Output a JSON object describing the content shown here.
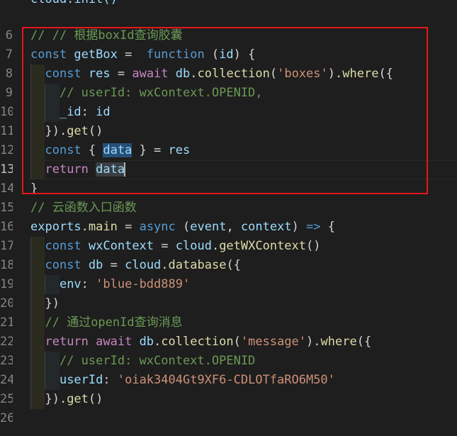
{
  "editor": {
    "top_partial_text": "cloud.init()",
    "lines": [
      {
        "num": "6",
        "tokens": [
          [
            "cmt",
            "// // 根据boxId查询胶囊"
          ]
        ]
      },
      {
        "num": "7",
        "tokens": [
          [
            "kw",
            "const "
          ],
          [
            "var",
            "getBox"
          ],
          [
            "pun",
            " =  "
          ],
          [
            "kw",
            "function"
          ],
          [
            "pun",
            " ("
          ],
          [
            "var",
            "id"
          ],
          [
            "pun",
            ") {"
          ]
        ]
      },
      {
        "num": "8",
        "tokens": [
          [
            "pun",
            "  "
          ],
          [
            "kw",
            "const "
          ],
          [
            "var",
            "res"
          ],
          [
            "pun",
            " = "
          ],
          [
            "kw2",
            "await "
          ],
          [
            "var",
            "db"
          ],
          [
            "pun",
            "."
          ],
          [
            "fn",
            "collection"
          ],
          [
            "pun",
            "("
          ],
          [
            "str",
            "'boxes'"
          ],
          [
            "pun",
            ")."
          ],
          [
            "fn",
            "where"
          ],
          [
            "pun",
            "({"
          ]
        ]
      },
      {
        "num": "9",
        "tokens": [
          [
            "pun",
            "    "
          ],
          [
            "cmt",
            "// userId: wxContext.OPENID,"
          ]
        ]
      },
      {
        "num": "10",
        "tokens": [
          [
            "pun",
            "    "
          ],
          [
            "var",
            "_id"
          ],
          [
            "pun",
            ": "
          ],
          [
            "var",
            "id"
          ]
        ]
      },
      {
        "num": "11",
        "tokens": [
          [
            "pun",
            "  })."
          ],
          [
            "fn",
            "get"
          ],
          [
            "pun",
            "()"
          ]
        ]
      },
      {
        "num": "12",
        "tokens": [
          [
            "pun",
            "  "
          ],
          [
            "kw",
            "const "
          ],
          [
            "pun",
            "{ "
          ],
          [
            "var hl",
            "data"
          ],
          [
            "pun",
            " } = "
          ],
          [
            "var",
            "res"
          ]
        ]
      },
      {
        "num": "13",
        "tokens": [
          [
            "pun",
            "  "
          ],
          [
            "kw2",
            "return "
          ],
          [
            "var hl2",
            "data"
          ]
        ],
        "active": true,
        "caret": true
      },
      {
        "num": "14",
        "tokens": [
          [
            "pun",
            "}"
          ]
        ]
      },
      {
        "num": "15",
        "tokens": [
          [
            "cmt",
            "// 云函数入口函数"
          ]
        ]
      },
      {
        "num": "16",
        "tokens": [
          [
            "var",
            "exports"
          ],
          [
            "pun",
            "."
          ],
          [
            "fn",
            "main"
          ],
          [
            "pun",
            " = "
          ],
          [
            "kw",
            "async"
          ],
          [
            "pun",
            " ("
          ],
          [
            "var",
            "event"
          ],
          [
            "pun",
            ", "
          ],
          [
            "var",
            "context"
          ],
          [
            "pun",
            ") "
          ],
          [
            "kw",
            "=>"
          ],
          [
            "pun",
            " {"
          ]
        ]
      },
      {
        "num": "17",
        "tokens": [
          [
            "pun",
            "  "
          ],
          [
            "kw",
            "const "
          ],
          [
            "var",
            "wxContext"
          ],
          [
            "pun",
            " = "
          ],
          [
            "var",
            "cloud"
          ],
          [
            "pun",
            "."
          ],
          [
            "fn",
            "getWXContext"
          ],
          [
            "pun",
            "()"
          ]
        ]
      },
      {
        "num": "18",
        "tokens": [
          [
            "pun",
            "  "
          ],
          [
            "kw",
            "const "
          ],
          [
            "var",
            "db"
          ],
          [
            "pun",
            " = "
          ],
          [
            "var",
            "cloud"
          ],
          [
            "pun",
            "."
          ],
          [
            "fn",
            "database"
          ],
          [
            "pun",
            "({"
          ]
        ]
      },
      {
        "num": "19",
        "tokens": [
          [
            "pun",
            "    "
          ],
          [
            "var",
            "env"
          ],
          [
            "pun",
            ": "
          ],
          [
            "str",
            "'blue-bdd889'"
          ]
        ]
      },
      {
        "num": "20",
        "tokens": [
          [
            "pun",
            "  })"
          ]
        ]
      },
      {
        "num": "21",
        "tokens": [
          [
            "pun",
            "  "
          ],
          [
            "cmt",
            "// 通过openId查询消息"
          ]
        ]
      },
      {
        "num": "22",
        "tokens": [
          [
            "pun",
            "  "
          ],
          [
            "kw2",
            "return "
          ],
          [
            "kw2",
            "await "
          ],
          [
            "var",
            "db"
          ],
          [
            "pun",
            "."
          ],
          [
            "fn",
            "collection"
          ],
          [
            "pun",
            "("
          ],
          [
            "str",
            "'message'"
          ],
          [
            "pun",
            ")."
          ],
          [
            "fn",
            "where"
          ],
          [
            "pun",
            "({"
          ]
        ]
      },
      {
        "num": "23",
        "tokens": [
          [
            "pun",
            "    "
          ],
          [
            "cmt",
            "// userId: wxContext.OPENID"
          ]
        ]
      },
      {
        "num": "24",
        "tokens": [
          [
            "pun",
            "    "
          ],
          [
            "var",
            "userId"
          ],
          [
            "pun",
            ": "
          ],
          [
            "str",
            "'oiak3404Gt9XF6-CDLOTfaRO6M50'"
          ]
        ]
      },
      {
        "num": "25",
        "tokens": [
          [
            "pun",
            "  })."
          ],
          [
            "fn",
            "get"
          ],
          [
            "pun",
            "()"
          ]
        ]
      },
      {
        "num": "26",
        "tokens": []
      }
    ]
  },
  "highlight": {
    "border_color": "#e8161a"
  }
}
